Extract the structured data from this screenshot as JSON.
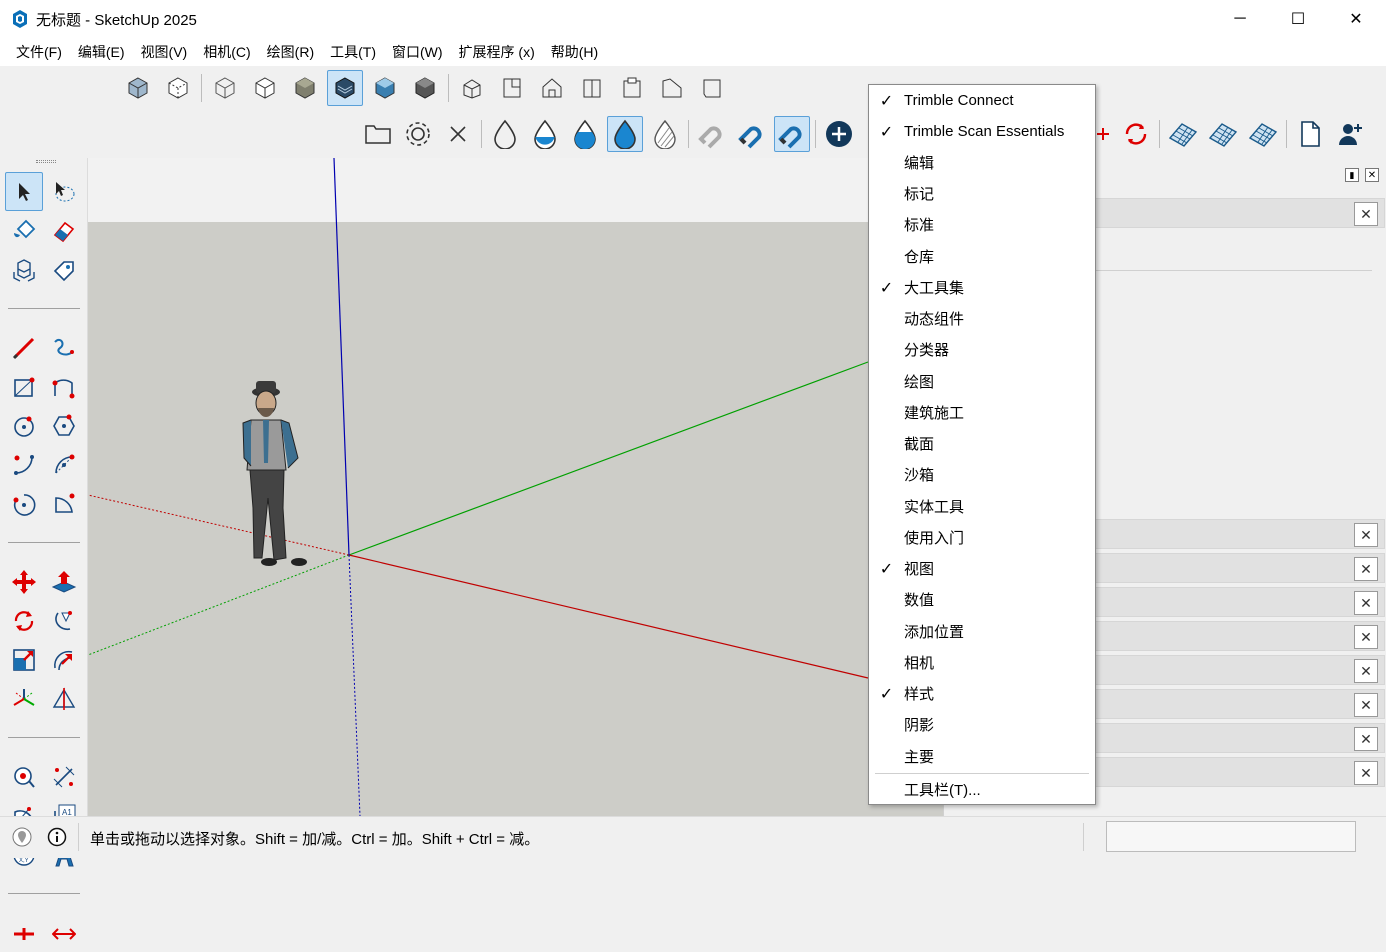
{
  "window": {
    "title": "无标题 - SketchUp 2025",
    "minimize": "─",
    "maximize": "☐",
    "close": "✕"
  },
  "menubar": {
    "items": [
      "文件(F)",
      "编辑(E)",
      "视图(V)",
      "相机(C)",
      "绘图(R)",
      "工具(T)",
      "窗口(W)",
      "扩展程序 (x)",
      "帮助(H)"
    ]
  },
  "context_menu": {
    "items": [
      {
        "label": "Trimble Connect",
        "checked": true
      },
      {
        "label": "Trimble Scan Essentials",
        "checked": true
      },
      {
        "label": "编辑",
        "checked": false
      },
      {
        "label": "标记",
        "checked": false
      },
      {
        "label": "标准",
        "checked": false
      },
      {
        "label": "仓库",
        "checked": false
      },
      {
        "label": "大工具集",
        "checked": true
      },
      {
        "label": "动态组件",
        "checked": false
      },
      {
        "label": "分类器",
        "checked": false
      },
      {
        "label": "绘图",
        "checked": false
      },
      {
        "label": "建筑施工",
        "checked": false
      },
      {
        "label": "截面",
        "checked": false
      },
      {
        "label": "沙箱",
        "checked": false
      },
      {
        "label": "实体工具",
        "checked": false
      },
      {
        "label": "使用入门",
        "checked": false
      },
      {
        "label": "视图",
        "checked": true
      },
      {
        "label": "数值",
        "checked": false
      },
      {
        "label": "添加位置",
        "checked": false
      },
      {
        "label": "相机",
        "checked": false
      },
      {
        "label": "样式",
        "checked": true
      },
      {
        "label": "阴影",
        "checked": false
      },
      {
        "label": "主要",
        "checked": false
      }
    ],
    "footer": "工具栏(T)...",
    "check_mark": "✓"
  },
  "tray": {
    "close_glyph": "✕",
    "pin_glyph": "📌"
  },
  "statusbar": {
    "hint": "单击或拖动以选择对象。Shift = 加/减。Ctrl = 加。Shift + Ctrl = 减。",
    "measurements_value": ""
  },
  "colors": {
    "accent": "#0a6fb8",
    "active_bg": "#cce4f7",
    "viewport_ground": "#cdcdc8",
    "axis_red": "#c00000",
    "axis_green": "#00a000",
    "axis_blue": "#0000b0"
  }
}
